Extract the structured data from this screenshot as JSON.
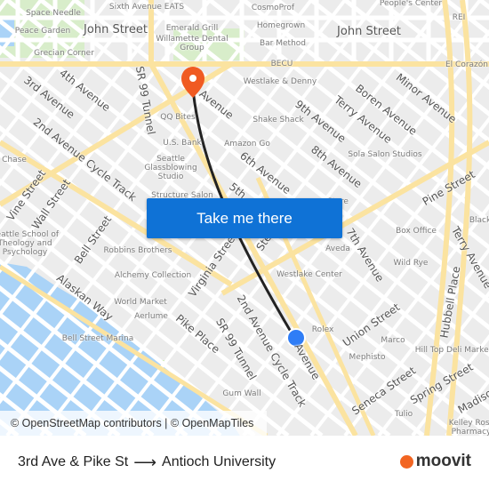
{
  "map": {
    "labels": [
      "Space Needle",
      "Peace Garden",
      "Grecian Corner",
      "John Street",
      "Sixth Avenue EATS",
      "Emerald Grill",
      "Willamette Dental Group",
      "CosmoProf",
      "Homegrown",
      "Bar Method",
      "People's Center",
      "REI",
      "John Street",
      "BECU",
      "El Corazón",
      "Westlake & Denny",
      "3rd Avenue",
      "4th Avenue",
      "SR 99 Tunnel",
      "Avenue",
      "QQ Bites",
      "U.S. Bank",
      "Amazon Go",
      "Shake Shack",
      "9th Avenue",
      "Terry Avenue",
      "Boren Avenue",
      "Minor Avenue",
      "2nd Avenue Cycle Track",
      "Chase",
      "Seattle Glassblowing Studio",
      "6th Avenue",
      "8th Avenue",
      "Sola Salon Studios",
      "5th",
      "Structure Salon",
      "Vine Street",
      "Wall Street",
      "Pine Street",
      "Store",
      "Black",
      "Seattle School of Theology and Psychology",
      "Bell Street",
      "Robbins Brothers",
      "Alchemy Collection",
      "Virginia Street",
      "Stewart",
      "Aveda",
      "7th Avenue",
      "Box Office",
      "Wild Rye",
      "Terry Avenue",
      "Hubbell Place",
      "Westlake Center",
      "Alaskan Way",
      "World Market",
      "Aerlume",
      "Pike Place",
      "SR 99 Tunnel",
      "2nd Avenue Cycle Track",
      "Bell Street Marina",
      "Rolex",
      "Union Street",
      "Marco",
      "Mephisto",
      "Hill Top Deli Market",
      "Avenue",
      "Seneca Street",
      "Spring Street",
      "Madison",
      "Gum Wall",
      "Tulio",
      "Kelley Ross Pharmacy"
    ],
    "cta_label": "Take me there",
    "attribution": "© OpenStreetMap contributors | © OpenMapTiles",
    "colors": {
      "route": "#222222",
      "destination_pin": "#f05a22",
      "origin_dot": "#2f7df6",
      "water": "#aad3f7",
      "park": "#d4ecc4",
      "major_road": "#fbe3a0",
      "cta": "#0f72d6"
    }
  },
  "footer": {
    "origin": "3rd Ave & Pike St",
    "arrow_icon": "arrow-right-icon",
    "destination": "Antioch University",
    "logo": "moovit"
  }
}
